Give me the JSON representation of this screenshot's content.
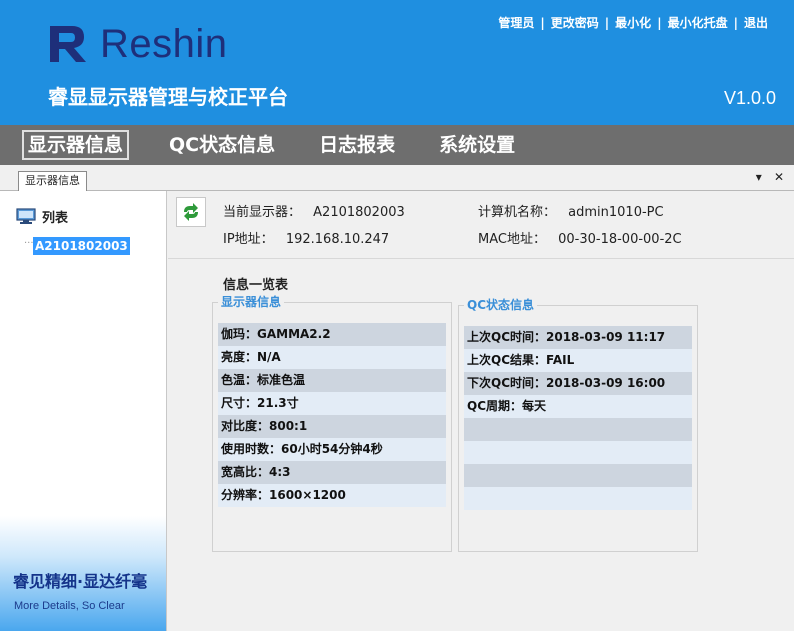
{
  "header": {
    "logo_text": "Reshin",
    "platform_title": "睿显显示器管理与校正平台",
    "version": "V1.0.0",
    "top_links": [
      "管理员",
      "更改密码",
      "最小化",
      "最小化托盘",
      "退出"
    ],
    "top_link_separator": "|"
  },
  "menu": {
    "items": [
      "显示器信息",
      "QC状态信息",
      "日志报表",
      "系统设置"
    ],
    "active_index": 0
  },
  "tabs": {
    "items": [
      "显示器信息"
    ],
    "controls": [
      "▾",
      "✕"
    ]
  },
  "sidebar": {
    "tree_root": "列表",
    "tree_connector": "....",
    "tree_child": "A2101802003",
    "slogan_cn": "睿见精细·显达纤毫",
    "slogan_en": "More Details, So Clear"
  },
  "info": {
    "current_display_label": "当前显示器：",
    "current_display_value": "A2101802003",
    "computer_name_label": "计算机名称：",
    "computer_name_value": "admin1010-PC",
    "ip_label": "IP地址：",
    "ip_value": "192.168.10.247",
    "mac_label": "MAC地址：",
    "mac_value": "00-30-18-00-00-2C"
  },
  "overview": {
    "title": "信息一览表",
    "display_group": {
      "title": "显示器信息",
      "rows": [
        "伽玛：GAMMA2.2",
        "亮度：N/A",
        "色温：标准色温",
        "尺寸：21.3寸",
        "对比度：800:1",
        "使用时数：60小时54分钟4秒",
        "宽高比：4:3",
        "分辨率：1600×1200"
      ]
    },
    "qc_group": {
      "title": "QC状态信息",
      "rows": [
        "上次QC时间：2018-03-09 11:17",
        "上次QC结果：FAIL",
        "下次QC时间：2018-03-09 16:00",
        "QC周期：每天",
        "",
        "",
        "",
        ""
      ]
    }
  },
  "colors": {
    "header_bg": "#1f8fe0",
    "menubar_bg": "#6e6e6e",
    "logo": "#1e2f7a",
    "group_title": "#3a8fd8",
    "selection": "#3399ff"
  }
}
